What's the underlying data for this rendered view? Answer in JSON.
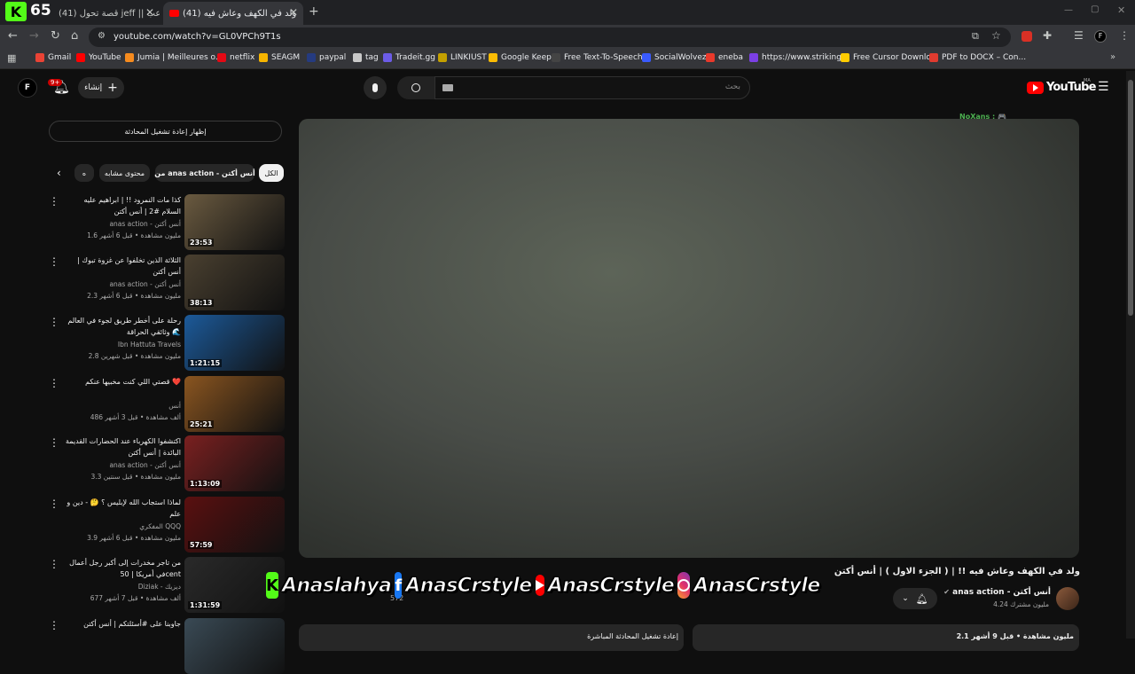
{
  "browser": {
    "tabs": [
      {
        "label": "(41) قصة تحول jeff || الارعب",
        "icon": "jeff-icon"
      },
      {
        "label": "(41) ولد في الكهف وعاش فيه",
        "icon": "youtube-icon"
      }
    ],
    "counter_badge": "65",
    "url": "youtube.com/watch?v=GL0VPCh9T1s",
    "bookmarks": [
      "Gmail",
      "YouTube",
      "Jumia | Meilleures o...",
      "netflix",
      "SEAGM",
      "paypal",
      "tag",
      "Tradeit.gg",
      "LINKIUST",
      "Google Keep",
      "Free Text-To-Speech...",
      "SocialWolvez",
      "eneba",
      "https://www.striking...",
      "Free Cursor Downlo...",
      "PDF to DOCX – Con..."
    ],
    "bookmark_colors": [
      "#ea4335",
      "#ff0000",
      "#f68b1e",
      "#e50914",
      "#f7b500",
      "#253b80",
      "#c9c9c9",
      "#6c5ce7",
      "#c4a000",
      "#fbbc04",
      "#444444",
      "#3a5bff",
      "#e9392b",
      "#7b3fe4",
      "#ffcc00",
      "#e03b2f"
    ]
  },
  "youtube": {
    "logo": "YouTube",
    "logo_region": "MA",
    "search_placeholder": "بحث",
    "create_label": "إنشاء",
    "notif_count": "9+",
    "avatar_letter": "F",
    "chat_replay": "إظهار إعادة تشغيل المحادثة",
    "chips": [
      "الكل",
      "من anas action - أنس أكتن",
      "محتوى مشابه",
      "ه"
    ],
    "watermark": "NoXans : 🎮",
    "related": [
      {
        "title": "كذا مات النمرود !! | ابراهيم عليه السلام #2 | أنس أكتن",
        "channel": "anas action - أنس أكتن",
        "meta": "1.6 مليون مشاهدة • قبل 6 أشهر",
        "duration": "23:53",
        "thumb_color": "#6a5a40"
      },
      {
        "title": "الثلاثة الذين تخلفوا عن غزوة تبوك | أنس أكتن",
        "channel": "anas action - أنس أكتن",
        "meta": "2.3 مليون مشاهدة • قبل 6 أشهر",
        "duration": "38:13",
        "thumb_color": "#4a4030"
      },
      {
        "title": "رحلة على أخطر طريق لجوء في العالم 🌊 وثائقي الحراقة",
        "channel": "Ibn Hattuta Travels",
        "meta": "2.8 مليون مشاهدة • قبل شهرين",
        "duration": "1:21:15",
        "thumb_color": "#1c5a9a"
      },
      {
        "title": "قصتي اللي كنت مخبيها عنكم ❤️",
        "channel": "أنس",
        "meta": "486 ألف مشاهدة • قبل 3 أشهر",
        "duration": "25:21",
        "thumb_color": "#8a5520"
      },
      {
        "title": "اكتشفوا الكهرباء عند الحضارات القديمة البائدة | أنس أكتن",
        "channel": "anas action - أنس أكتن",
        "meta": "3.3 مليون مشاهدة • قبل سنتين",
        "duration": "1:13:09",
        "thumb_color": "#7a2020"
      },
      {
        "title": "لماذا استجاب الله لإبليس ؟ 🤔 - دين و علم",
        "channel": "المفكري QQQ",
        "meta": "3.9 مليون مشاهدة • قبل 6 أشهر",
        "duration": "57:59",
        "thumb_color": "#5a1010"
      },
      {
        "title": "من تاجر مخدرات إلى أكبر رجل أعمال في أمريكا | 50cent",
        "channel": "Diziak - ديزيك",
        "meta": "677 ألف مشاهدة • قبل 7 أشهر",
        "duration": "1:31:59",
        "thumb_color": "#2a2a2a"
      },
      {
        "title": "جاوبنا على #أسئلتكم | أنس أكتن",
        "channel": "",
        "meta": "",
        "duration": "",
        "thumb_color": "#3a4a55"
      }
    ],
    "video_title": "ولد في الكهف وعاش فيه !! | ( الجزء الاول ) | أنس أكتن",
    "channel_name": "anas action - أنس أكتن",
    "subscribers": "4.24 مليون مشترك",
    "like_count": "572",
    "view_line": "2.1 مليون مشاهدة • قبل 9 أشهر",
    "chat_replay_bottom": "إعادة تشغيل المحادثة المباشرة",
    "banner": {
      "kick": "Anaslahya",
      "facebook": "AnasCrstyle",
      "youtube": "AnasCrstyle",
      "instagram": "AnasCrstyle"
    }
  }
}
